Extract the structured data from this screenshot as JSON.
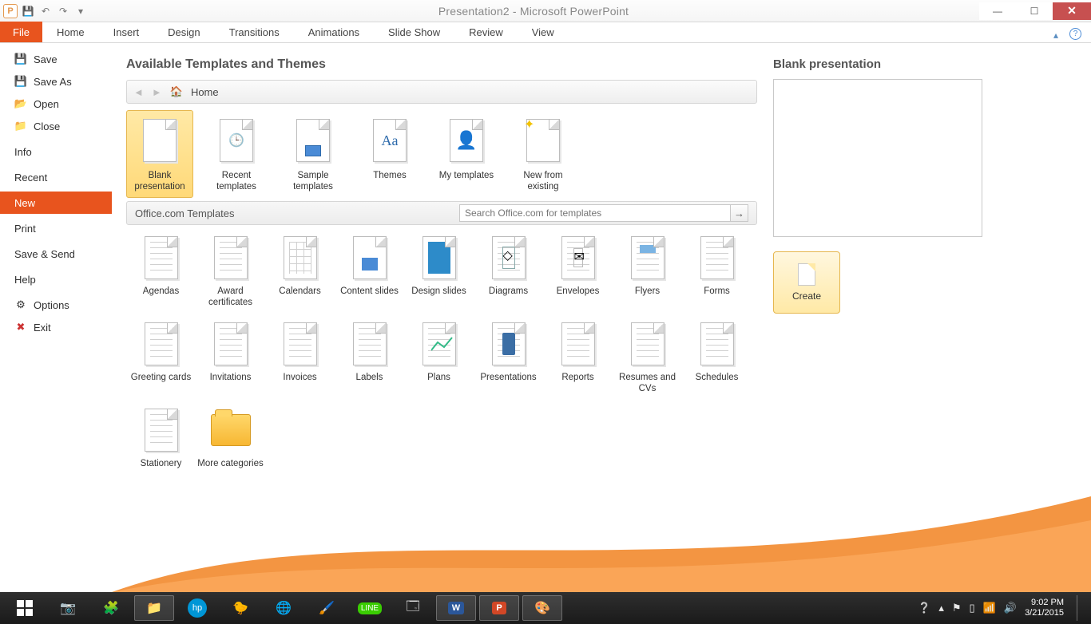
{
  "titlebar": {
    "title": "Presentation2 - Microsoft PowerPoint"
  },
  "ribbon": {
    "file": "File",
    "tabs": [
      "Home",
      "Insert",
      "Design",
      "Transitions",
      "Animations",
      "Slide Show",
      "Review",
      "View"
    ]
  },
  "sidebar": {
    "items": [
      {
        "label": "Save",
        "icon": "save"
      },
      {
        "label": "Save As",
        "icon": "save-as"
      },
      {
        "label": "Open",
        "icon": "open"
      },
      {
        "label": "Close",
        "icon": "close"
      },
      {
        "label": "Info"
      },
      {
        "label": "Recent"
      },
      {
        "label": "New",
        "selected": true
      },
      {
        "label": "Print"
      },
      {
        "label": "Save & Send"
      },
      {
        "label": "Help"
      },
      {
        "label": "Options",
        "icon": "options"
      },
      {
        "label": "Exit",
        "icon": "exit"
      }
    ]
  },
  "main": {
    "heading": "Available Templates and Themes",
    "breadcrumb": "Home",
    "top_tiles": [
      {
        "label": "Blank presentation",
        "selected": true
      },
      {
        "label": "Recent templates"
      },
      {
        "label": "Sample templates"
      },
      {
        "label": "Themes"
      },
      {
        "label": "My templates"
      },
      {
        "label": "New from existing"
      }
    ],
    "office_section": "Office.com Templates",
    "search_placeholder": "Search Office.com for templates",
    "categories": [
      "Agendas",
      "Award certificates",
      "Calendars",
      "Content slides",
      "Design slides",
      "Diagrams",
      "Envelopes",
      "Flyers",
      "Forms",
      "Greeting cards",
      "Invitations",
      "Invoices",
      "Labels",
      "Plans",
      "Presentations",
      "Reports",
      "Resumes and CVs",
      "Schedules",
      "Stationery",
      "More categories"
    ]
  },
  "preview": {
    "title": "Blank presentation",
    "create": "Create"
  },
  "taskbar": {
    "time": "9:02 PM",
    "date": "3/21/2015"
  }
}
